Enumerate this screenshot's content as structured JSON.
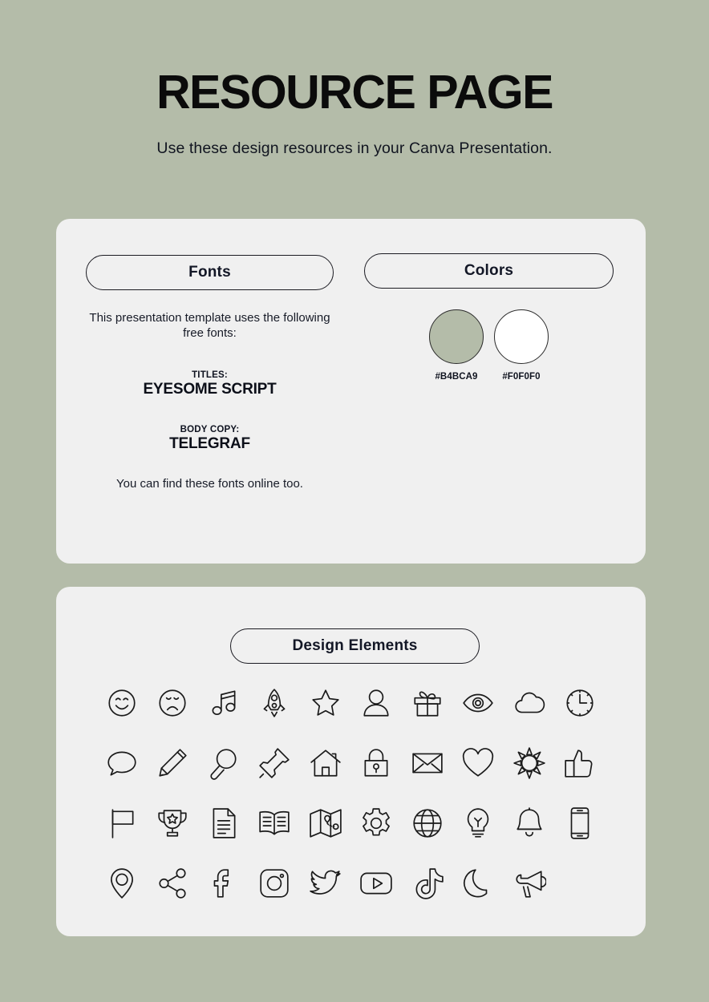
{
  "header": {
    "title": "RESOURCE PAGE",
    "subtitle": "Use these design resources in your Canva Presentation."
  },
  "fonts_card": {
    "fonts_pill": "Fonts",
    "colors_pill": "Colors",
    "intro": "This presentation template uses the following free fonts:",
    "titles_kicker": "TITLES:",
    "titles_font": "EYESOME SCRIPT",
    "body_kicker": "BODY COPY:",
    "body_font": "TELEGRAF",
    "footer": "You can find these fonts online too.",
    "swatches": [
      {
        "hex": "#B4BCA9",
        "label": "#B4BCA9"
      },
      {
        "hex": "#FFFFFF",
        "label": "#F0F0F0"
      }
    ]
  },
  "elements_card": {
    "pill": "Design Elements",
    "icons": [
      "smiley-face-icon",
      "sad-face-icon",
      "music-note-icon",
      "rocket-icon",
      "star-icon",
      "person-icon",
      "gift-icon",
      "eye-icon",
      "cloud-icon",
      "clock-icon",
      "speech-bubble-icon",
      "pencil-icon",
      "magnifying-glass-icon",
      "push-pin-icon",
      "house-icon",
      "lock-icon",
      "envelope-icon",
      "heart-icon",
      "sun-icon",
      "thumbs-up-icon",
      "flag-icon",
      "trophy-icon",
      "document-icon",
      "book-icon",
      "map-icon",
      "gear-icon",
      "globe-icon",
      "lightbulb-icon",
      "bell-icon",
      "phone-icon",
      "location-pin-icon",
      "share-icon",
      "facebook-icon",
      "instagram-icon",
      "twitter-icon",
      "youtube-icon",
      "tiktok-icon",
      "moon-icon",
      "megaphone-icon"
    ]
  }
}
